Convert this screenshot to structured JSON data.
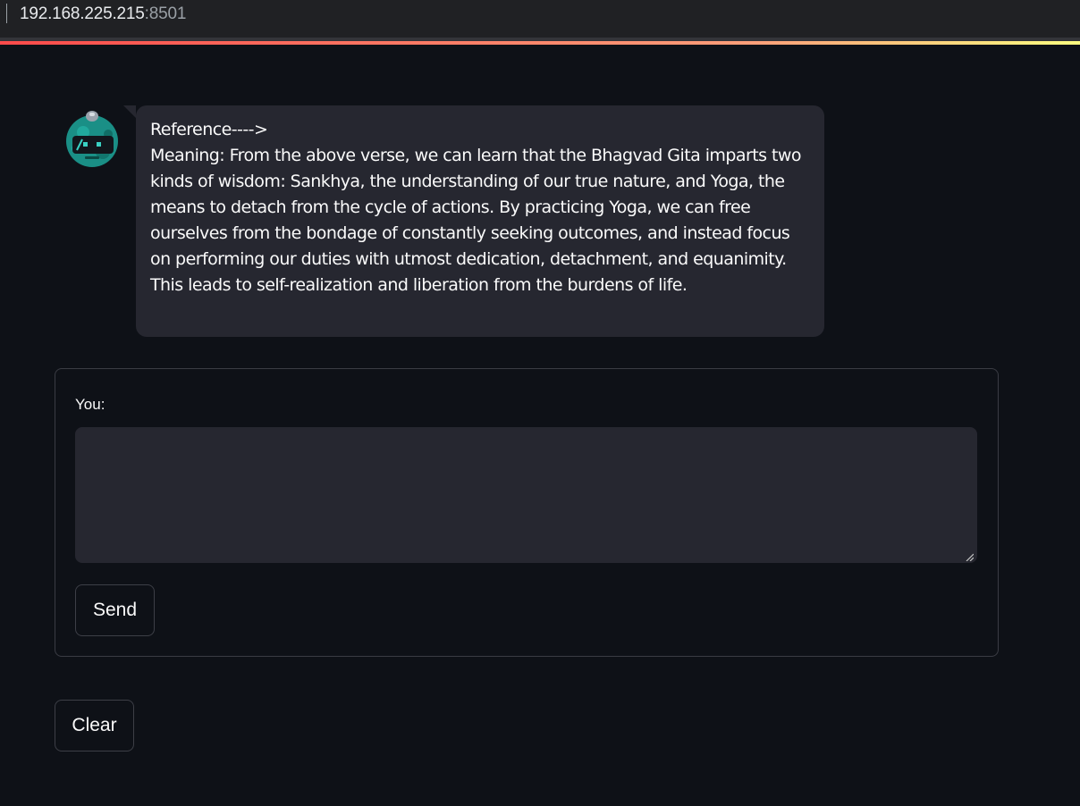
{
  "browser": {
    "url_host": "192.168.225.215",
    "url_port": ":8501"
  },
  "chat": {
    "messages": [
      {
        "role": "assistant",
        "avatar_icon": "robot-icon",
        "heading": "Reference---->",
        "text": "Meaning: From the above verse, we can learn that the Bhagvad Gita imparts two kinds of wisdom: Sankhya, the understanding of our true nature, and Yoga, the means to detach from the cycle of actions. By practicing Yoga, we can free ourselves from the bondage of constantly seeking outcomes, and instead focus on performing our duties with utmost dedication, detachment, and equanimity. This leads to self-realization and liberation from the burdens of life."
      }
    ]
  },
  "form": {
    "label": "You:",
    "input_value": "",
    "send_label": "Send"
  },
  "actions": {
    "clear_label": "Clear"
  },
  "colors": {
    "background": "#0e1117",
    "bubble": "#262730",
    "input": "#262730",
    "border": "#3d3f47",
    "avatar_teal": "#1a8f86",
    "decoration_start": "#ff4b4b",
    "decoration_end": "#fffd80"
  }
}
